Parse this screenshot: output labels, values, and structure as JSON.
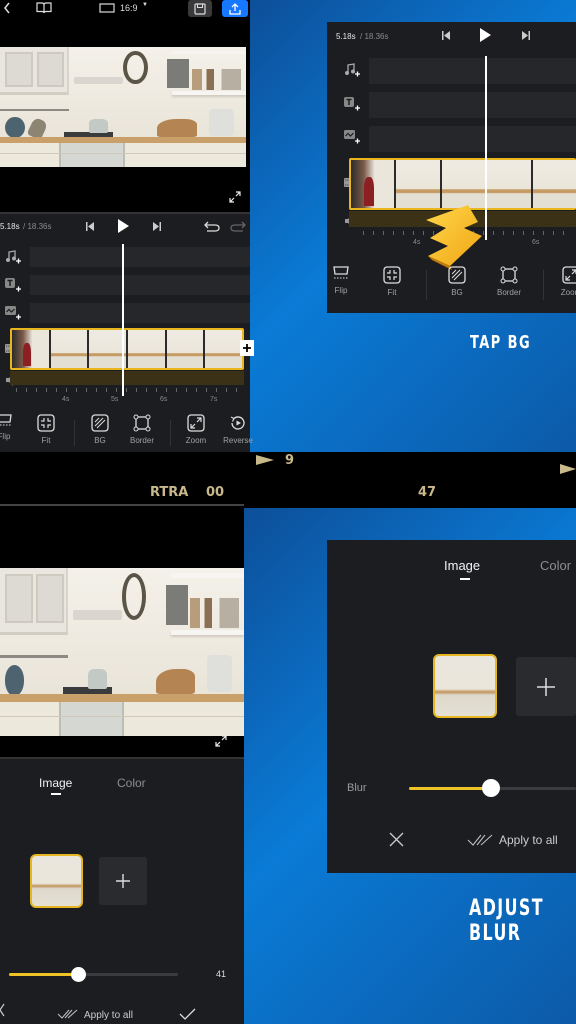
{
  "top_left_editor": {
    "header": {
      "back_icon": "chevron-left-icon",
      "guide_icon": "book-icon",
      "aspect_ratio": "16:9",
      "save_icon": "save-icon",
      "export_icon": "export-upload-icon"
    },
    "playback": {
      "current_time": "5.18s",
      "total_time": "/ 18.36s"
    },
    "tracks": [
      "music-add",
      "text-add",
      "sticker-add",
      "video-add",
      "audio"
    ],
    "ruler_ticks": [
      "4s",
      "5s",
      "6s",
      "7s"
    ],
    "toolbar": [
      {
        "label": "Flip",
        "icon": "flip-icon"
      },
      {
        "label": "Fit",
        "icon": "fit-icon"
      },
      {
        "label": "BG",
        "icon": "background-icon"
      },
      {
        "label": "Border",
        "icon": "border-icon"
      },
      {
        "label": "Zoom",
        "icon": "zoom-icon"
      },
      {
        "label": "Reverse",
        "icon": "reverse-icon"
      }
    ]
  },
  "top_right_step": {
    "playback": {
      "current_time": "5.18s",
      "total_time": "/ 18.36s"
    },
    "ruler_ticks": [
      "4s",
      "6s"
    ],
    "toolbar": [
      {
        "label": "Flip"
      },
      {
        "label": "Fit"
      },
      {
        "label": "BG"
      },
      {
        "label": "Border"
      },
      {
        "label": "Zoom"
      }
    ],
    "caption": "TAP BG",
    "pointer": "arrow-pointer-icon"
  },
  "film_strip": {
    "frame_marker": "9",
    "label": "RTRA",
    "number_left": "00",
    "number_right": "47"
  },
  "bottom_left_editor": {
    "tabs": [
      {
        "label": "Image",
        "active": true
      },
      {
        "label": "Color",
        "active": false
      }
    ],
    "blur_value": "41",
    "blur_fraction": 0.41,
    "apply_all_label": "Apply to all",
    "actions": {
      "cancel_icon": "close-icon",
      "confirm_icon": "check-icon"
    }
  },
  "bottom_right_step": {
    "tabs": [
      {
        "label": "Image",
        "active": true
      },
      {
        "label": "Color",
        "active": false
      }
    ],
    "blur_label": "Blur",
    "blur_fraction": 0.41,
    "apply_all_label": "Apply to all",
    "caption": "ADJUST BLUR"
  },
  "colors": {
    "accent_yellow": "#e9b61e",
    "export_blue": "#1677ff",
    "panel_dark": "#1c1d20",
    "bg_blue": "#0a7bd6"
  }
}
